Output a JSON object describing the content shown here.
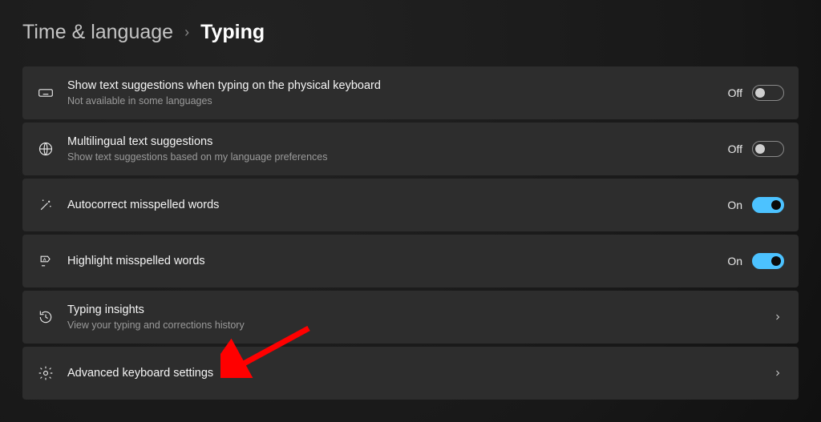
{
  "breadcrumb": {
    "parent": "Time & language",
    "current": "Typing"
  },
  "toggle_labels": {
    "on": "On",
    "off": "Off"
  },
  "rows": [
    {
      "icon": "keyboard-icon",
      "title": "Show text suggestions when typing on the physical keyboard",
      "subtitle": "Not available in some languages",
      "control": "toggle",
      "state": "off"
    },
    {
      "icon": "translate-icon",
      "title": "Multilingual text suggestions",
      "subtitle": "Show text suggestions based on my language preferences",
      "control": "toggle",
      "state": "off"
    },
    {
      "icon": "wand-icon",
      "title": "Autocorrect misspelled words",
      "subtitle": "",
      "control": "toggle",
      "state": "on"
    },
    {
      "icon": "highlight-icon",
      "title": "Highlight misspelled words",
      "subtitle": "",
      "control": "toggle",
      "state": "on"
    },
    {
      "icon": "history-icon",
      "title": "Typing insights",
      "subtitle": "View your typing and corrections history",
      "control": "nav"
    },
    {
      "icon": "gear-icon",
      "title": "Advanced keyboard settings",
      "subtitle": "",
      "control": "nav"
    }
  ],
  "annotation": {
    "type": "arrow",
    "target_row_index": 5,
    "color": "#ff0000"
  }
}
